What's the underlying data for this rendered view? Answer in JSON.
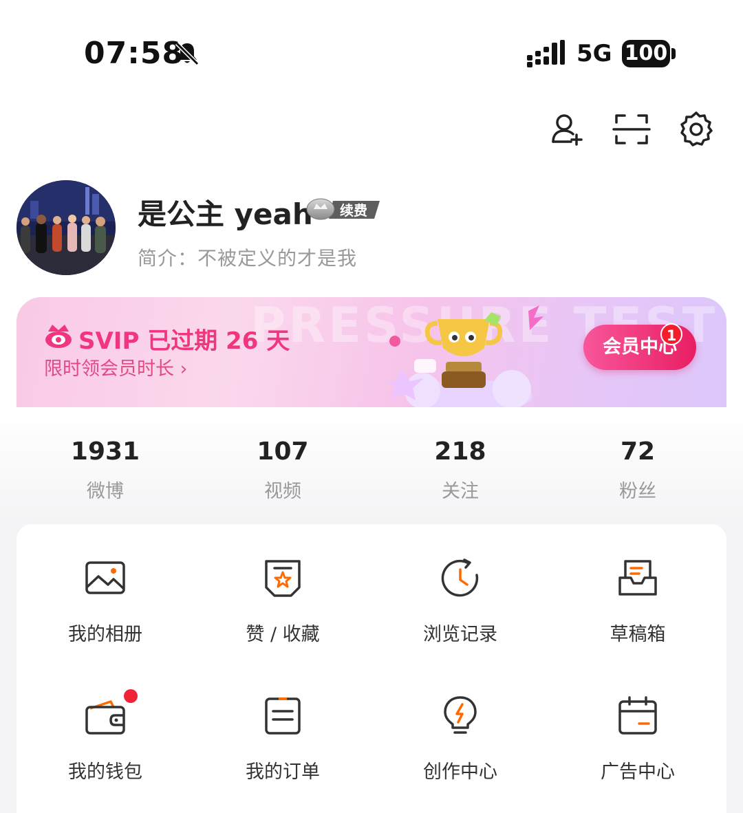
{
  "status_bar": {
    "time": "07:58",
    "network": "5G",
    "battery": "100"
  },
  "top_actions": {
    "icons": [
      "add-friend-icon",
      "scan-icon",
      "gear-icon"
    ]
  },
  "profile": {
    "username": "是公主 yeah",
    "vip_badge": "续费",
    "bio": "简介：不被定义的才是我"
  },
  "banner": {
    "title": "SVIP 已过期 26 天",
    "subtitle": "限时领会员时长",
    "subtitle_arrow": "›",
    "member_button": "会员中心",
    "badge_count": "1",
    "bg_text": "PRESSURE TEST",
    "accent_color": "#f0367e"
  },
  "stats": [
    {
      "value": "1931",
      "label": "微博"
    },
    {
      "value": "107",
      "label": "视频"
    },
    {
      "value": "218",
      "label": "关注"
    },
    {
      "value": "72",
      "label": "粉丝"
    }
  ],
  "grid": [
    {
      "label": "我的相册",
      "icon": "photo-album-icon"
    },
    {
      "label": "赞 / 收藏",
      "icon": "favorites-icon"
    },
    {
      "label": "浏览记录",
      "icon": "history-icon"
    },
    {
      "label": "草稿箱",
      "icon": "drafts-icon"
    },
    {
      "label": "我的钱包",
      "icon": "wallet-icon"
    },
    {
      "label": "我的订单",
      "icon": "orders-icon"
    },
    {
      "label": "创作中心",
      "icon": "creator-icon"
    },
    {
      "label": "广告中心",
      "icon": "ads-icon"
    }
  ]
}
